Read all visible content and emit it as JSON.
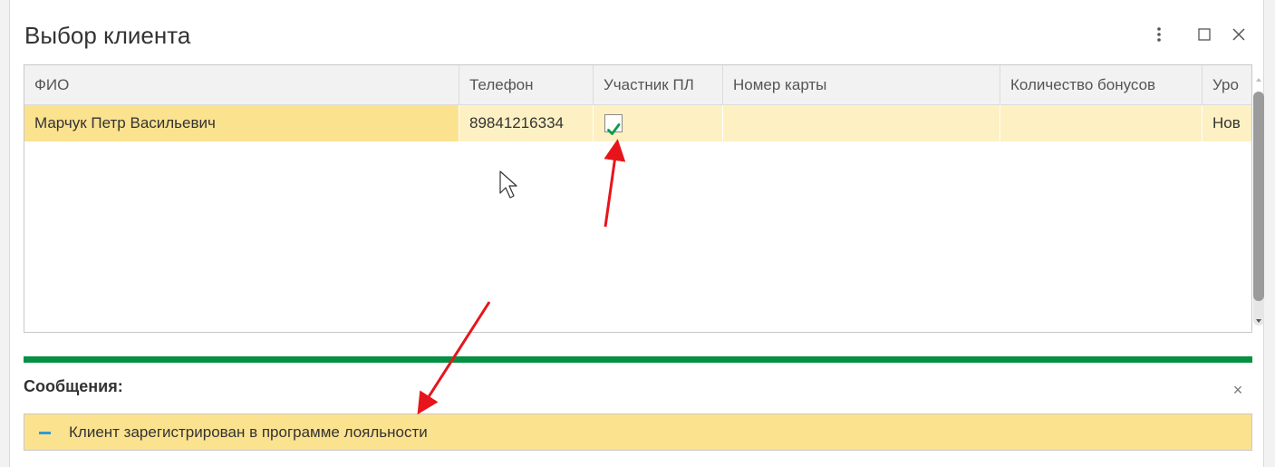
{
  "dialog": {
    "title": "Выбор клиента"
  },
  "icons": {
    "more": "more-vertical-icon",
    "maximize": "maximize-icon",
    "close": "close-icon",
    "checkbox": "checkmark-icon",
    "message_bullet": "dash-icon",
    "cursor": "mouse-cursor-icon"
  },
  "table": {
    "columns": [
      "ФИО",
      "Телефон",
      "Участник ПЛ",
      "Номер карты",
      "Количество бонусов",
      "Уро"
    ],
    "rows": [
      {
        "fio": "Марчук Петр Васильевич",
        "phone": "89841216334",
        "loyalty_member": true,
        "card_number": "",
        "bonus_count": "",
        "level": "Нов"
      }
    ]
  },
  "messages": {
    "title": "Сообщения:",
    "close_symbol": "×",
    "items": [
      "Клиент зарегистрирован в программе лояльности"
    ]
  },
  "colors": {
    "accent_green": "#069044",
    "selection_yellow": "#fbe28f",
    "row_highlight": "#fdf0c2",
    "annotation_arrow": "#e8141b",
    "message_bullet": "#2f9bd6"
  }
}
